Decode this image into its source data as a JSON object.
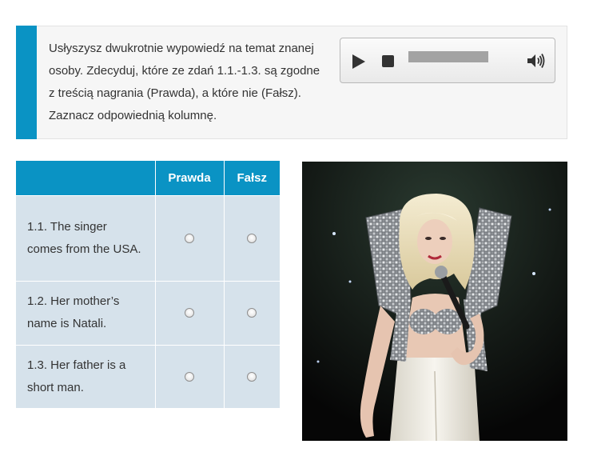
{
  "instruction": {
    "text": "Usłyszysz dwukrotnie wypowiedź na temat znanej osoby. Zdecyduj, które ze zdań 1.1.-1.3. są zgodne z treścią nagrania (Prawda), a które nie (Fałsz). Zaznacz odpowiednią kolumnę."
  },
  "player": {
    "icons": [
      "play-icon",
      "stop-icon",
      "speaker-icon"
    ],
    "progress": 0
  },
  "table": {
    "headers": [
      "",
      "Prawda",
      "Fałsz"
    ],
    "rows": [
      {
        "question": "1.1. The singer comes from the USA."
      },
      {
        "question": "1.2. Her mother’s name is Natali."
      },
      {
        "question": "1.3. Her father is a short man."
      }
    ]
  },
  "colors": {
    "accent": "#0a93c4",
    "row_bg": "#d6e2eb",
    "panel_bg": "#f6f6f6"
  }
}
